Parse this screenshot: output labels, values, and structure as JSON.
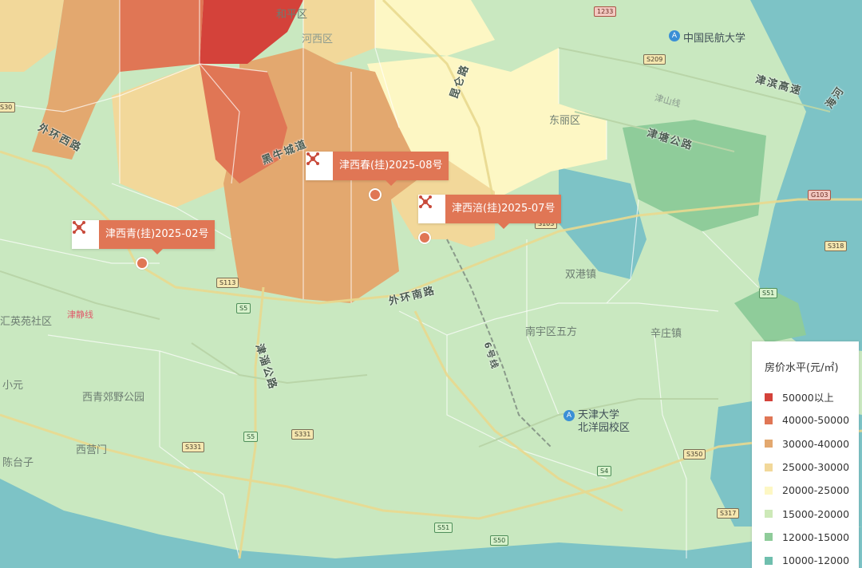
{
  "districts": {
    "heping": "和平区",
    "hexi": "河西区",
    "dongli": "东丽区",
    "shuanggang": "双港镇",
    "nanqu": "南宇区五方",
    "xinzhuang": "辛庄镇",
    "xiqing_park": "西青郊野公园",
    "xiyingmen": "西营门",
    "chentaizi": "陈台子",
    "xiaoyuan": "小元",
    "yingyuan": "汇英苑社区"
  },
  "roads": {
    "waihuan_xi": "外环西路",
    "heiniucheng": "黑牛城道",
    "waihuan_nan": "外环南路",
    "jinjing": "津静线",
    "jinzi": "津淄公路",
    "line6": "6号线",
    "jinbin": "津滨高速",
    "jintang": "津塘公路",
    "jinshan": "津山线",
    "kunlun": "昆仑路",
    "haihe": "海河"
  },
  "pois": {
    "caac": "中国民航大学",
    "tju": "天津大学\n北洋园校区",
    "pin_glyph": "A"
  },
  "shields": [
    "S209",
    "S113",
    "S5",
    "S5",
    "S331",
    "S331",
    "S4",
    "S51",
    "S50",
    "S350",
    "S317",
    "S318",
    "S51",
    "G103",
    "S103",
    "1233",
    "S30"
  ],
  "markers": [
    {
      "label": "津西青(挂)2025-02号",
      "icon": "land-parcel-icon"
    },
    {
      "label": "津西春(挂)2025-08号",
      "icon": "land-parcel-icon"
    },
    {
      "label": "津西涪(挂)2025-07号",
      "icon": "land-parcel-icon"
    }
  ],
  "legend": {
    "title": "房价水平(元/㎡)",
    "items": [
      {
        "label": "50000以上",
        "color": "#d4423a"
      },
      {
        "label": "40000-50000",
        "color": "#e07655"
      },
      {
        "label": "30000-40000",
        "color": "#e3a86f"
      },
      {
        "label": "25000-30000",
        "color": "#f2d89a"
      },
      {
        "label": "20000-25000",
        "color": "#fdf7c4"
      },
      {
        "label": "15000-20000",
        "color": "#cde9b8"
      },
      {
        "label": "12000-15000",
        "color": "#8fcc9a"
      },
      {
        "label": "10000-12000",
        "color": "#6fbfae"
      }
    ]
  },
  "colors": {
    "base_green": "#c9e8c0",
    "teal": "#7dc3c6",
    "deep_teal": "#6bb4c2"
  }
}
